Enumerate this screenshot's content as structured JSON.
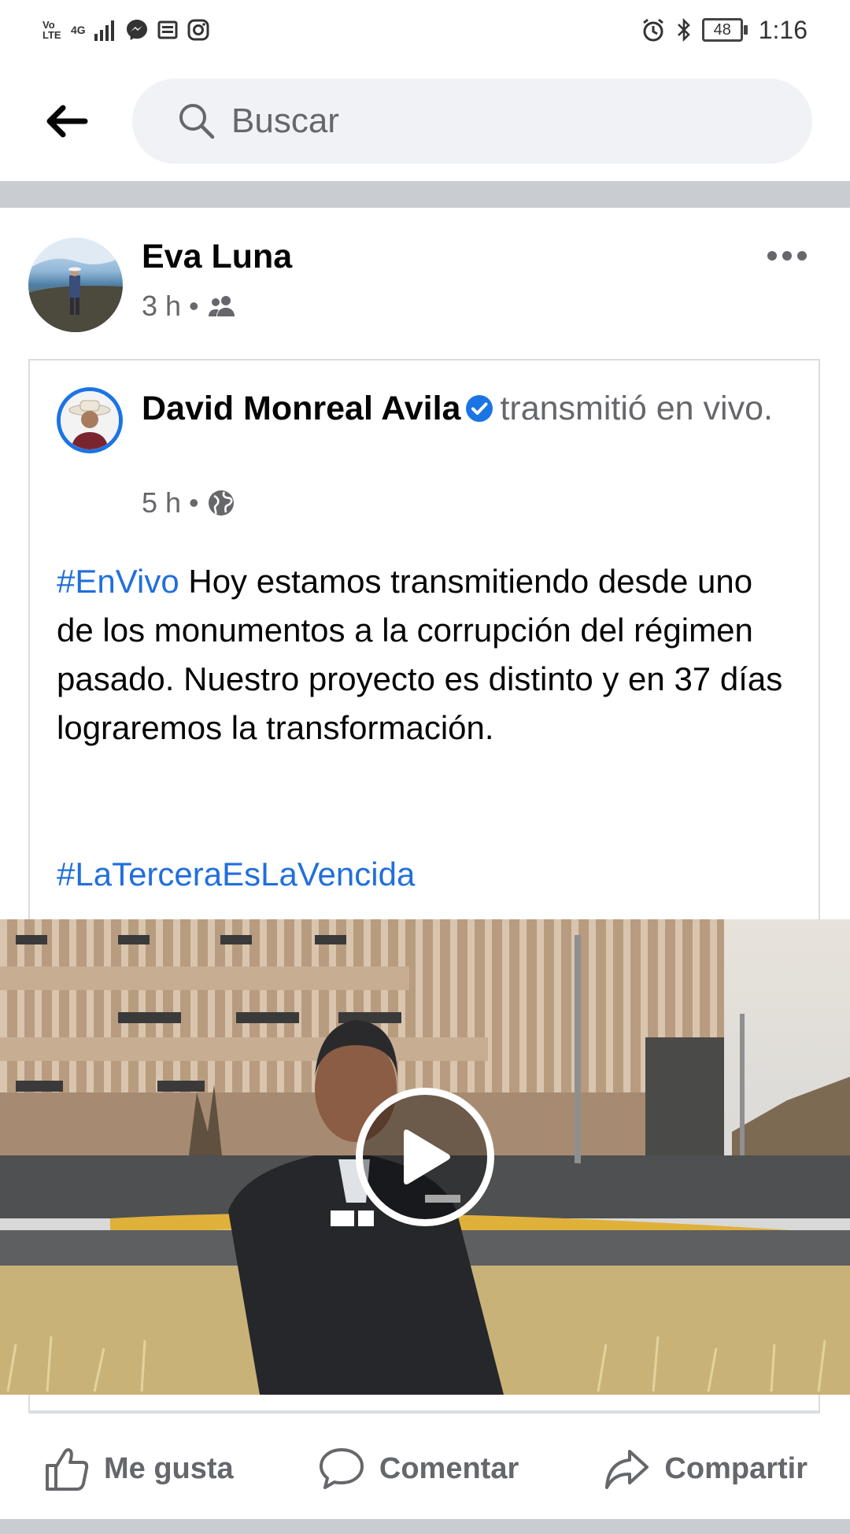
{
  "status_bar": {
    "volte": "Vo LTE",
    "network": "4G",
    "battery": "48",
    "time": "1:16"
  },
  "search": {
    "placeholder": "Buscar"
  },
  "post": {
    "author": "Eva Luna",
    "time": "3 h",
    "audience_icon": "friends-icon"
  },
  "shared": {
    "author": "David Monreal Avila",
    "action": "transmitió en vivo.",
    "time": "5 h",
    "audience_icon": "globe-icon",
    "hashtag1": "#EnVivo",
    "body": "Hoy estamos transmitiendo desde uno de los monumentos a la corrupción del régimen pasado. Nuestro proyecto es distinto y en 37 días lograremos la transformación.",
    "hashtag2": "#LaTerceraEsLaVencida"
  },
  "actions": {
    "like": "Me gusta",
    "comment": "Comentar",
    "share": "Compartir"
  },
  "colors": {
    "link": "#216fdb",
    "verified": "#1b74e4",
    "secondary_text": "#65676b"
  }
}
